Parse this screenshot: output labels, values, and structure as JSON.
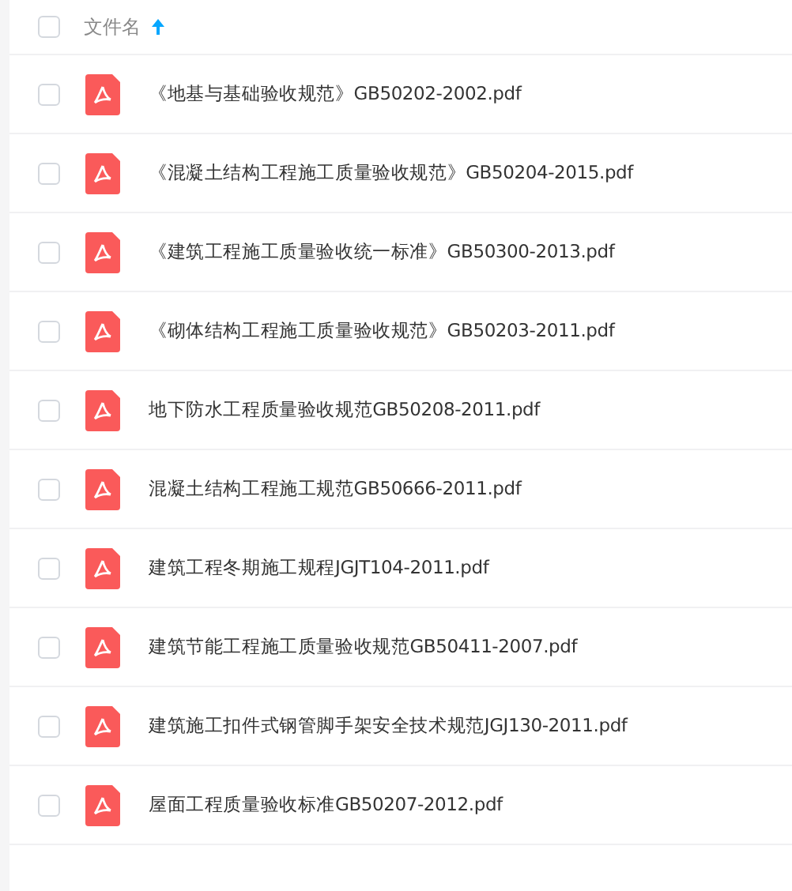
{
  "header": {
    "checked": false,
    "column": "文件名",
    "sort_ascending": true
  },
  "files": [
    {
      "name": "《地基与基础验收规范》GB50202-2002.pdf",
      "checked": false
    },
    {
      "name": "《混凝土结构工程施工质量验收规范》GB50204-2015.pdf",
      "checked": false
    },
    {
      "name": "《建筑工程施工质量验收统一标准》GB50300-2013.pdf",
      "checked": false
    },
    {
      "name": "《砌体结构工程施工质量验收规范》GB50203-2011.pdf",
      "checked": false
    },
    {
      "name": "地下防水工程质量验收规范GB50208-2011.pdf",
      "checked": false
    },
    {
      "name": "混凝土结构工程施工规范GB50666-2011.pdf",
      "checked": false
    },
    {
      "name": "建筑工程冬期施工规程JGJT104-2011.pdf",
      "checked": false
    },
    {
      "name": "建筑节能工程施工质量验收规范GB50411-2007.pdf",
      "checked": false
    },
    {
      "name": "建筑施工扣件式钢管脚手架安全技术规范JGJ130-2011.pdf",
      "checked": false
    },
    {
      "name": "屋面工程质量验收标准GB50207-2012.pdf",
      "checked": false
    }
  ]
}
